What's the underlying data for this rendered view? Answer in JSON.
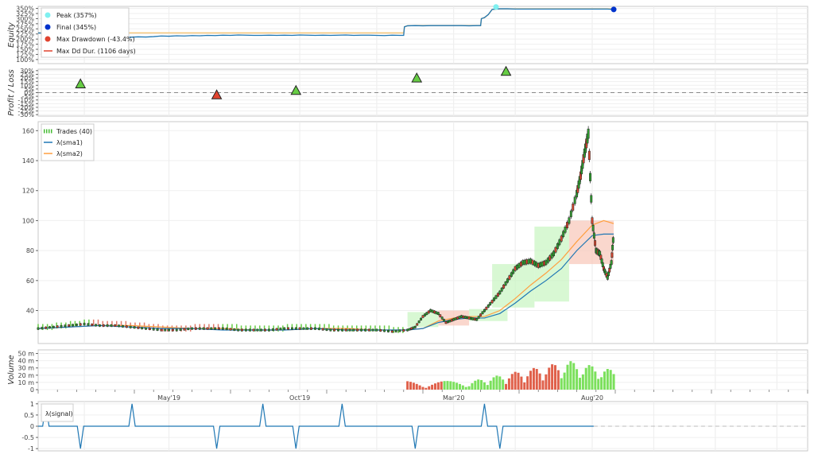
{
  "chart_data": [
    {
      "id": "equity",
      "type": "line",
      "ylabel": "Equity",
      "ylim": [
        80,
        360
      ],
      "yticks": [
        "100%",
        "125%",
        "150%",
        "175%",
        "200%",
        "225%",
        "250%",
        "275%",
        "300%",
        "325%",
        "350%"
      ],
      "ytick_values": [
        100,
        125,
        150,
        175,
        200,
        225,
        250,
        275,
        300,
        325,
        350
      ],
      "legend": [
        {
          "label": "Peak (357%)",
          "color": "#7ff0f0",
          "shape": "circle"
        },
        {
          "label": "Final (345%)",
          "color": "#0033cc",
          "shape": "circle"
        },
        {
          "label": "Max Drawdown (-43.4%)",
          "color": "#e0432f",
          "shape": "circle"
        },
        {
          "label": "Max Dd Dur. (1106 days)",
          "color": "#e0432f",
          "shape": "line"
        }
      ],
      "series": [
        {
          "name": "Equity",
          "color": "#1f77b4",
          "x": [
            0,
            10,
            20,
            30,
            40,
            50,
            60,
            70,
            80,
            90,
            100,
            110,
            120,
            130,
            140,
            150,
            160,
            170,
            180,
            190,
            200,
            210,
            220,
            230,
            240,
            250,
            260,
            270,
            280,
            290,
            300,
            310,
            320,
            330,
            340,
            350,
            360,
            370,
            380,
            390,
            400,
            410,
            420,
            430,
            440,
            450,
            460,
            470,
            475,
            476,
            480,
            490,
            500,
            510,
            520,
            530,
            540,
            550,
            560,
            570,
            575,
            576,
            580,
            585,
            590,
            600,
            610,
            620,
            630,
            640,
            650,
            660,
            670,
            680,
            690,
            700,
            710,
            720,
            730,
            740,
            748
          ],
          "y": [
            230,
            229,
            230,
            228,
            229,
            227,
            229,
            230,
            210,
            212,
            208,
            210,
            209,
            211,
            210,
            212,
            215,
            214,
            216,
            215,
            217,
            216,
            218,
            217,
            219,
            218,
            220,
            219,
            218,
            218,
            219,
            218,
            219,
            218,
            220,
            219,
            218,
            219,
            218,
            219,
            220,
            218,
            219,
            219,
            218,
            217,
            219,
            218,
            218,
            260,
            265,
            266,
            265,
            266,
            266,
            266,
            266,
            266,
            265,
            266,
            266,
            300,
            305,
            320,
            345,
            348,
            348,
            347,
            347,
            347,
            347,
            347,
            347,
            347,
            347,
            347,
            347,
            347,
            347,
            347,
            345
          ]
        }
      ],
      "peak": {
        "x": 595,
        "y": 357
      },
      "final": {
        "x": 748,
        "y": 345
      },
      "maxdd_band": {
        "x0": 80,
        "x1": 748,
        "y0": 210,
        "y1": 250
      }
    },
    {
      "id": "pnl",
      "type": "scatter",
      "ylabel": "Profit / Loss",
      "ylim": [
        -32,
        32
      ],
      "yticks": [
        "-30%",
        "-25%",
        "-20%",
        "-15%",
        "-10%",
        "-5%",
        "0%",
        "5%",
        "10%",
        "15%",
        "20%",
        "25%",
        "30%"
      ],
      "ytick_values": [
        -30,
        -25,
        -20,
        -15,
        -10,
        -5,
        0,
        5,
        10,
        15,
        20,
        25,
        30
      ],
      "points": [
        {
          "x": 55,
          "value": 12,
          "color": "#66cc44"
        },
        {
          "x": 232,
          "value": -3,
          "color": "#e0432f"
        },
        {
          "x": 335,
          "value": 3,
          "color": "#66cc44"
        },
        {
          "x": 492,
          "value": 20,
          "color": "#66cc44"
        },
        {
          "x": 608,
          "value": 29,
          "color": "#66cc44"
        }
      ]
    },
    {
      "id": "price",
      "type": "line",
      "ylim": [
        18,
        166
      ],
      "yticks": [
        "40",
        "60",
        "80",
        "100",
        "120",
        "140",
        "160"
      ],
      "ytick_values": [
        40,
        60,
        80,
        100,
        120,
        140,
        160
      ],
      "legend": [
        {
          "label": "Trades (40)",
          "color": "#44bb33",
          "shape": "dashbar"
        },
        {
          "label": "λ(sma1)",
          "color": "#1f77b4",
          "shape": "line"
        },
        {
          "label": "λ(sma2)",
          "color": "#ff9f40",
          "shape": "line"
        }
      ],
      "close": {
        "x": [
          0,
          20,
          40,
          60,
          80,
          100,
          120,
          140,
          160,
          180,
          200,
          220,
          240,
          260,
          280,
          300,
          320,
          340,
          360,
          380,
          400,
          420,
          440,
          460,
          480,
          490,
          500,
          510,
          520,
          530,
          540,
          550,
          560,
          570,
          580,
          590,
          600,
          610,
          620,
          630,
          640,
          650,
          660,
          670,
          680,
          690,
          700,
          705,
          710,
          715,
          720,
          725,
          730,
          735,
          740,
          745,
          748
        ],
        "y": [
          28,
          29,
          30,
          31,
          30,
          30,
          29,
          28,
          27,
          27,
          28,
          28,
          28,
          27,
          27,
          27,
          28,
          28,
          28,
          27,
          27,
          27,
          27,
          26,
          27,
          29,
          36,
          40,
          38,
          32,
          34,
          36,
          35,
          34,
          40,
          46,
          52,
          60,
          68,
          72,
          73,
          70,
          72,
          78,
          88,
          100,
          118,
          130,
          145,
          158,
          100,
          80,
          78,
          68,
          62,
          72,
          92
        ]
      },
      "sma1": {
        "x": [
          0,
          40,
          80,
          120,
          160,
          200,
          240,
          280,
          320,
          360,
          400,
          440,
          480,
          500,
          520,
          540,
          560,
          580,
          600,
          620,
          640,
          660,
          680,
          700,
          720,
          735,
          748
        ],
        "y": [
          28,
          29,
          30,
          29,
          28,
          28,
          27,
          27,
          27,
          28,
          27,
          27,
          27,
          28,
          32,
          34,
          35,
          35,
          38,
          45,
          53,
          60,
          68,
          80,
          90,
          91,
          91
        ]
      },
      "sma2": {
        "x": [
          0,
          40,
          80,
          120,
          160,
          200,
          240,
          280,
          320,
          360,
          400,
          440,
          480,
          500,
          520,
          540,
          560,
          580,
          600,
          620,
          640,
          660,
          680,
          700,
          720,
          735,
          748
        ],
        "y": [
          28,
          29,
          30,
          30,
          29,
          28,
          28,
          27,
          27,
          28,
          28,
          27,
          27,
          28,
          33,
          35,
          36,
          36,
          40,
          48,
          57,
          65,
          74,
          86,
          97,
          100,
          98
        ]
      },
      "trade_boxes": [
        {
          "x0": 480,
          "x1": 520,
          "y0": 29,
          "y1": 39,
          "win": true
        },
        {
          "x0": 520,
          "x1": 560,
          "y0": 30,
          "y1": 40,
          "win": false
        },
        {
          "x0": 560,
          "x1": 610,
          "y0": 33,
          "y1": 41,
          "win": true
        },
        {
          "x0": 590,
          "x1": 645,
          "y0": 42,
          "y1": 71,
          "win": true
        },
        {
          "x0": 645,
          "x1": 690,
          "y0": 46,
          "y1": 96,
          "win": true
        },
        {
          "x0": 690,
          "x1": 748,
          "y0": 71,
          "y1": 100,
          "win": false
        }
      ]
    },
    {
      "id": "volume",
      "type": "bar",
      "ylabel": "Volume",
      "ylim": [
        0,
        55
      ],
      "yticks": [
        "0",
        "10 m",
        "20 m",
        "30 m",
        "40 m",
        "50 m"
      ],
      "ytick_values": [
        0,
        10,
        20,
        30,
        40,
        50
      ],
      "active_from": 480,
      "peak_x": 690,
      "x_labels": [
        "May'19",
        "Oct'19",
        "Mar'20",
        "Aug'20"
      ],
      "x_label_pos": [
        170,
        340,
        540,
        720
      ]
    },
    {
      "id": "signal",
      "type": "line",
      "legend": [
        {
          "label": "λ(signal)",
          "color": "#1f77b4",
          "shape": "line"
        }
      ],
      "ylim": [
        -1.1,
        1.1
      ],
      "yticks": [
        "-1",
        "-0.5",
        "0",
        "0.5",
        "1"
      ],
      "ytick_values": [
        -1,
        -0.5,
        0,
        0.5,
        1
      ],
      "spikes": [
        {
          "x": 10,
          "value": 1
        },
        {
          "x": 55,
          "value": -1
        },
        {
          "x": 122,
          "value": 1
        },
        {
          "x": 232,
          "value": -1
        },
        {
          "x": 292,
          "value": 1
        },
        {
          "x": 335,
          "value": -1
        },
        {
          "x": 395,
          "value": 1
        },
        {
          "x": 490,
          "value": -1
        },
        {
          "x": 580,
          "value": 1
        },
        {
          "x": 600,
          "value": -1
        }
      ],
      "end_x": 722
    }
  ]
}
